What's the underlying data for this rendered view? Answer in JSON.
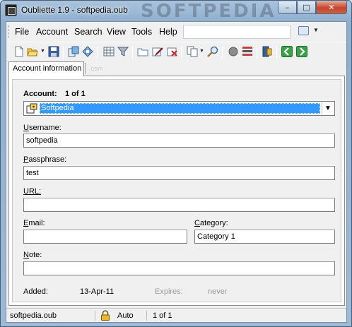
{
  "window": {
    "title": "Oubliette 1.9 - softpedia.oub",
    "watermark": "SOFTPEDIA",
    "minimize_glyph": "–",
    "maximize_glyph": "□",
    "close_glyph": "✕"
  },
  "menu": {
    "items": [
      "File",
      "Account",
      "Search",
      "View",
      "Tools",
      "Help"
    ],
    "search_value": "",
    "find_dropdown_glyph": "▼"
  },
  "toolbar": {
    "icons": [
      "new-file-icon",
      "open-folder-icon",
      "save-icon",
      "copy-account-icon",
      "paste-account-icon",
      "grid-view-icon",
      "filter-icon",
      "new-folder-icon",
      "edit-icon",
      "delete-icon",
      "copy-icon",
      "find-icon",
      "record-icon",
      "list-icon",
      "lock-file-icon",
      "back-icon",
      "forward-icon"
    ],
    "dropdown_glyph": "▼"
  },
  "tabs": [
    {
      "label": "Account information"
    }
  ],
  "tab_ghost_text": ".com",
  "form": {
    "account_label": "Account:",
    "account_counter": "1 of 1",
    "account_selected": "Softpedia",
    "combo_arrow": "▼",
    "username_label": "Username:",
    "username_value": "softpedia",
    "passphrase_label": "Passphrase:",
    "passphrase_value": "test",
    "url_label": "URL:",
    "url_value": "",
    "email_label": "Email:",
    "email_value": "",
    "category_label": "Category:",
    "category_value": "Category 1",
    "note_label": "Note:",
    "note_value": "",
    "added_label": "Added:",
    "added_value": "13-Apr-11",
    "expires_label": "Expires:",
    "expires_value": "never"
  },
  "status": {
    "file": "softpedia.oub",
    "lock_mode": "Auto",
    "count": "1 of 1"
  },
  "colors": {
    "selection": "#3399ff",
    "close_button": "#c5442b"
  }
}
